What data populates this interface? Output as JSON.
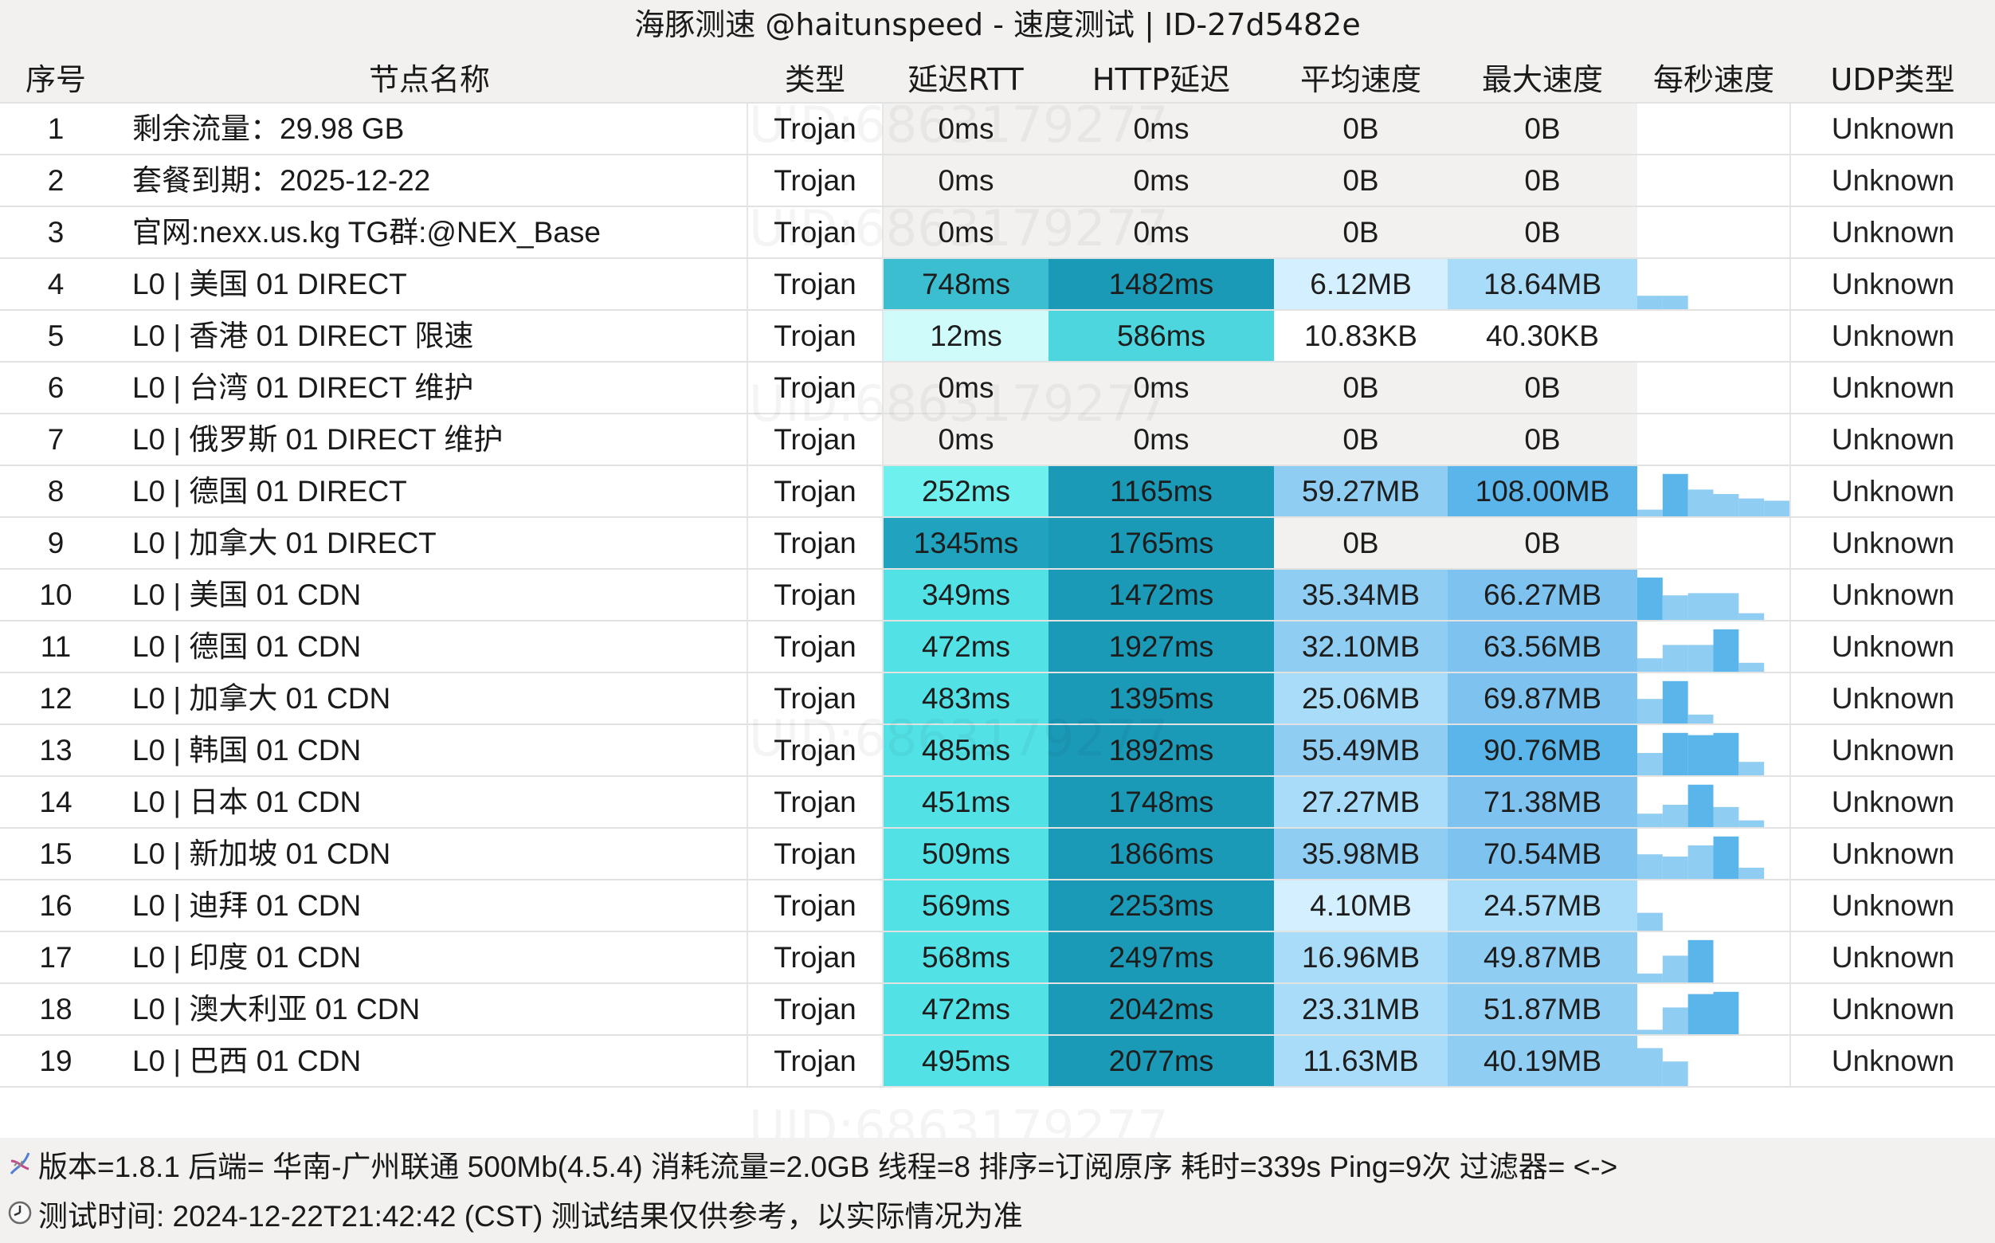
{
  "title": "海豚测速 @haitunspeed - 速度测试 | ID-27d5482e",
  "columns": [
    "序号",
    "节点名称",
    "类型",
    "延迟RTT",
    "HTTP延迟",
    "平均速度",
    "最大速度",
    "每秒速度",
    "UDP类型"
  ],
  "rows": [
    {
      "no": "1",
      "name": "剩余流量：29.98 GB",
      "type": "Trojan",
      "rtt": "0ms",
      "http": "0ms",
      "avg": "0B",
      "max": "0B",
      "spark": [],
      "udp": "Unknown"
    },
    {
      "no": "2",
      "name": "套餐到期：2025-12-22",
      "type": "Trojan",
      "rtt": "0ms",
      "http": "0ms",
      "avg": "0B",
      "max": "0B",
      "spark": [],
      "udp": "Unknown"
    },
    {
      "no": "3",
      "name": "官网:nexx.us.kg TG群:@NEX_Base",
      "type": "Trojan",
      "rtt": "0ms",
      "http": "0ms",
      "avg": "0B",
      "max": "0B",
      "spark": [],
      "udp": "Unknown"
    },
    {
      "no": "4",
      "name": "L0 | 美国 01 DIRECT",
      "type": "Trojan",
      "rtt": "748ms",
      "http": "1482ms",
      "avg": "6.12MB",
      "max": "18.64MB",
      "spark": [
        0.3,
        0.3
      ],
      "udp": "Unknown"
    },
    {
      "no": "5",
      "name": "L0 | 香港 01 DIRECT 限速",
      "type": "Trojan",
      "rtt": "12ms",
      "http": "586ms",
      "avg": "10.83KB",
      "max": "40.30KB",
      "spark": [],
      "udp": "Unknown"
    },
    {
      "no": "6",
      "name": "L0 | 台湾 01 DIRECT 维护",
      "type": "Trojan",
      "rtt": "0ms",
      "http": "0ms",
      "avg": "0B",
      "max": "0B",
      "spark": [],
      "udp": "Unknown"
    },
    {
      "no": "7",
      "name": "L0 | 俄罗斯 01 DIRECT 维护",
      "type": "Trojan",
      "rtt": "0ms",
      "http": "0ms",
      "avg": "0B",
      "max": "0B",
      "spark": [],
      "udp": "Unknown"
    },
    {
      "no": "8",
      "name": "L0 | 德国 01 DIRECT",
      "type": "Trojan",
      "rtt": "252ms",
      "http": "1165ms",
      "avg": "59.27MB",
      "max": "108.00MB",
      "spark": [
        0.15,
        0.95,
        0.6,
        0.5,
        0.4,
        0.35
      ],
      "udp": "Unknown"
    },
    {
      "no": "9",
      "name": "L0 | 加拿大 01 DIRECT",
      "type": "Trojan",
      "rtt": "1345ms",
      "http": "1765ms",
      "avg": "0B",
      "max": "0B",
      "spark": [],
      "udp": "Unknown"
    },
    {
      "no": "10",
      "name": "L0 | 美国 01 CDN",
      "type": "Trojan",
      "rtt": "349ms",
      "http": "1472ms",
      "avg": "35.34MB",
      "max": "66.27MB",
      "spark": [
        0.95,
        0.55,
        0.6,
        0.6,
        0.15
      ],
      "udp": "Unknown"
    },
    {
      "no": "11",
      "name": "L0 | 德国 01 CDN",
      "type": "Trojan",
      "rtt": "472ms",
      "http": "1927ms",
      "avg": "32.10MB",
      "max": "63.56MB",
      "spark": [
        0.3,
        0.6,
        0.6,
        0.95,
        0.2
      ],
      "udp": "Unknown"
    },
    {
      "no": "12",
      "name": "L0 | 加拿大 01 CDN",
      "type": "Trojan",
      "rtt": "483ms",
      "http": "1395ms",
      "avg": "25.06MB",
      "max": "69.87MB",
      "spark": [
        0.55,
        0.95,
        0.2
      ],
      "udp": "Unknown"
    },
    {
      "no": "13",
      "name": "L0 | 韩国 01 CDN",
      "type": "Trojan",
      "rtt": "485ms",
      "http": "1892ms",
      "avg": "55.49MB",
      "max": "90.76MB",
      "spark": [
        0.5,
        0.95,
        0.9,
        0.95,
        0.3
      ],
      "udp": "Unknown"
    },
    {
      "no": "14",
      "name": "L0 | 日本 01 CDN",
      "type": "Trojan",
      "rtt": "451ms",
      "http": "1748ms",
      "avg": "27.27MB",
      "max": "71.38MB",
      "spark": [
        0.3,
        0.5,
        0.95,
        0.45,
        0.15
      ],
      "udp": "Unknown"
    },
    {
      "no": "15",
      "name": "L0 | 新加坡 01 CDN",
      "type": "Trojan",
      "rtt": "509ms",
      "http": "1866ms",
      "avg": "35.98MB",
      "max": "70.54MB",
      "spark": [
        0.55,
        0.5,
        0.75,
        0.95,
        0.25
      ],
      "udp": "Unknown"
    },
    {
      "no": "16",
      "name": "L0 | 迪拜 01 CDN",
      "type": "Trojan",
      "rtt": "569ms",
      "http": "2253ms",
      "avg": "4.10MB",
      "max": "24.57MB",
      "spark": [
        0.4
      ],
      "udp": "Unknown"
    },
    {
      "no": "17",
      "name": "L0 | 印度 01 CDN",
      "type": "Trojan",
      "rtt": "568ms",
      "http": "2497ms",
      "avg": "16.96MB",
      "max": "49.87MB",
      "spark": [
        0.2,
        0.6,
        0.95
      ],
      "udp": "Unknown"
    },
    {
      "no": "18",
      "name": "L0 | 澳大利亚 01 CDN",
      "type": "Trojan",
      "rtt": "472ms",
      "http": "2042ms",
      "avg": "23.31MB",
      "max": "51.87MB",
      "spark": [
        0.1,
        0.6,
        0.9,
        0.95
      ],
      "udp": "Unknown"
    },
    {
      "no": "19",
      "name": "L0 | 巴西 01 CDN",
      "type": "Trojan",
      "rtt": "495ms",
      "http": "2077ms",
      "avg": "11.63MB",
      "max": "40.19MB",
      "spark": [
        0.85,
        0.55
      ],
      "udp": "Unknown"
    }
  ],
  "footer": {
    "line1": "版本=1.8.1  后端=   华南-广州联通 500Mb(4.5.4) 消耗流量=2.0GB  线程=8  排序=订阅原序  耗时=339s  Ping=9次  过滤器= <->",
    "line2": "测试时间: 2024-12-22T21:42:42 (CST)  测试结果仅供参考，以实际情况为准",
    "icon1": "dna-icon",
    "icon2": "clock-icon"
  },
  "watermark": "UID:6863179277",
  "colors": {
    "header_bg": "#f2f1f0",
    "grey_cell": "#f2f1f0",
    "spark_light": "#8fcdf2",
    "spark_dark": "#5ab5ea"
  }
}
